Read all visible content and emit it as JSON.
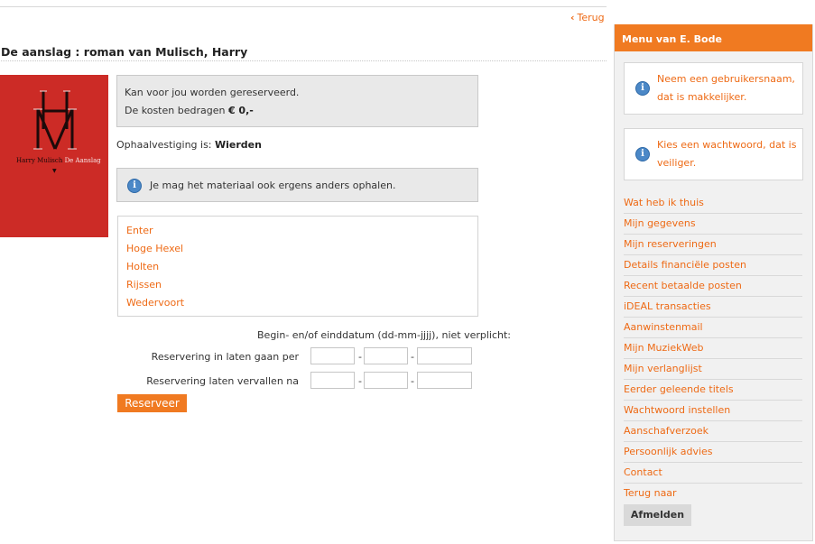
{
  "nav": {
    "back_label": "Terug"
  },
  "item": {
    "title": "De aanslag : roman van Mulisch, Harry",
    "cover": {
      "monogram": "HM",
      "author": "Harry Mulisch",
      "book": "De Aanslag"
    }
  },
  "reservation": {
    "available_text": "Kan voor jou worden gereserveerd.",
    "cost_text": "De kosten bedragen",
    "cost_value": "€ 0,-",
    "pickup_label": "Ophaalvestiging is:",
    "pickup_branch": "Wierden",
    "info_text": "Je mag het materiaal ook ergens anders ophalen.",
    "locations": [
      "Enter",
      "Hoge Hexel",
      "Holten",
      "Rijssen",
      "Wedervoort"
    ],
    "date_note": "Begin- en/of einddatum (dd-mm-jjjj), niet verplicht:",
    "start_label": "Reservering in laten gaan per",
    "end_label": "Reservering laten vervallen na",
    "date_separator": "-",
    "submit_label": "Reserveer"
  },
  "sidebar": {
    "title": "Menu van E. Bode",
    "notices": [
      "Neem een gebruikersnaam, dat is makkelijker.",
      "Kies een wachtwoord, dat is veiliger."
    ],
    "menu": [
      "Wat heb ik thuis",
      "Mijn gegevens",
      "Mijn reserveringen",
      "Details financiële posten",
      "Recent betaalde posten",
      "iDEAL transacties",
      "Aanwinstenmail",
      "Mijn MuziekWeb",
      "Mijn verlanglijst",
      "Eerder geleende titels",
      "Wachtwoord instellen",
      "Aanschafverzoek",
      "Persoonlijk advies",
      "Contact",
      "Terug naar"
    ],
    "logout_label": "Afmelden"
  },
  "colors": {
    "accent": "#f07a21",
    "link": "#ee6a15",
    "info_icon": "#4b88c7"
  }
}
